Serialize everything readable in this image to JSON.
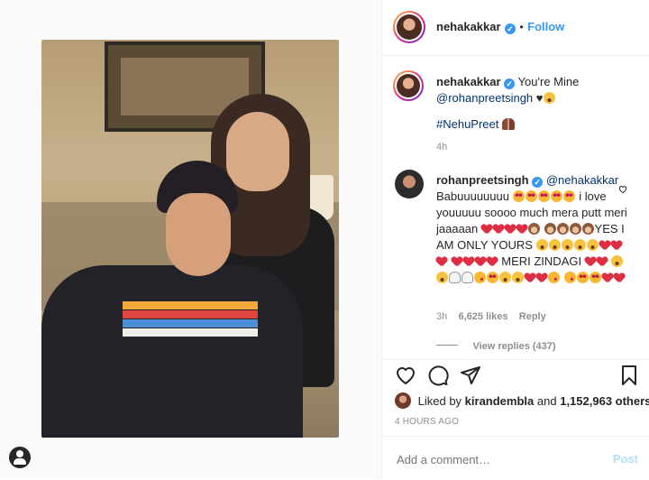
{
  "post": {
    "username": "nehakakkar",
    "follow_label": "Follow",
    "separator": "•"
  },
  "caption": {
    "username": "nehakakkar",
    "text_1": "You're Mine",
    "mention": "@rohanpreetsingh",
    "text_2": "♥",
    "hashtag": "#NehuPreet",
    "time": "4h"
  },
  "comment": {
    "username": "rohanpreetsingh",
    "mention": "@nehakakkar",
    "line_1": "Babuuuuuuuu",
    "line_2": "i love youuuuu soooo much mera putt meri jaaaaan",
    "line_3": "YES I AM ONLY YOURS",
    "line_4": "MERI ZINDAGI",
    "time": "3h",
    "likes": "6,625 likes",
    "reply_label": "Reply",
    "view_replies": "View replies (437)"
  },
  "likes_bar": {
    "prefix": "Liked by",
    "user": "kirandembla",
    "and": "and",
    "count": "1,152,963 others"
  },
  "date": "4 HOURS AGO",
  "add_comment": {
    "placeholder": "Add a comment…",
    "post_label": "Post"
  },
  "icons": {
    "heart": "heart-icon",
    "comment": "comment-icon",
    "share": "share-icon",
    "save": "bookmark-icon",
    "verified": "verified-badge-icon",
    "profile": "profile-icon"
  },
  "colors": {
    "accent": "#3897f0",
    "text": "#262626",
    "muted": "#8e8e8e"
  }
}
